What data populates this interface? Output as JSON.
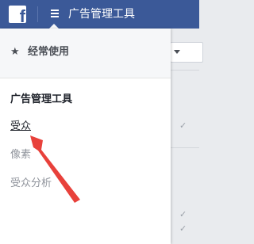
{
  "topbar": {
    "logo_letter": "f",
    "title": "广告管理工具"
  },
  "menu": {
    "favorites_label": "经常使用",
    "section_title": "广告管理工具",
    "items": [
      {
        "label": "受众",
        "state": "active"
      },
      {
        "label": "像素",
        "state": "disabled"
      },
      {
        "label": "受众分析",
        "state": "disabled"
      }
    ]
  },
  "icons": {
    "logo": "facebook-logo-icon",
    "menu": "hamburger-icon",
    "favorites": "star-icon",
    "background_rows": "checkmark-icon",
    "annotation": "red-arrow"
  },
  "colors": {
    "topbar": "#3b5998",
    "menu_background": "#ffffff",
    "favorites_background": "#f6f7f9",
    "active_text": "#1d2129",
    "muted_text": "#90949c",
    "annotation_arrow": "#e8413b"
  }
}
